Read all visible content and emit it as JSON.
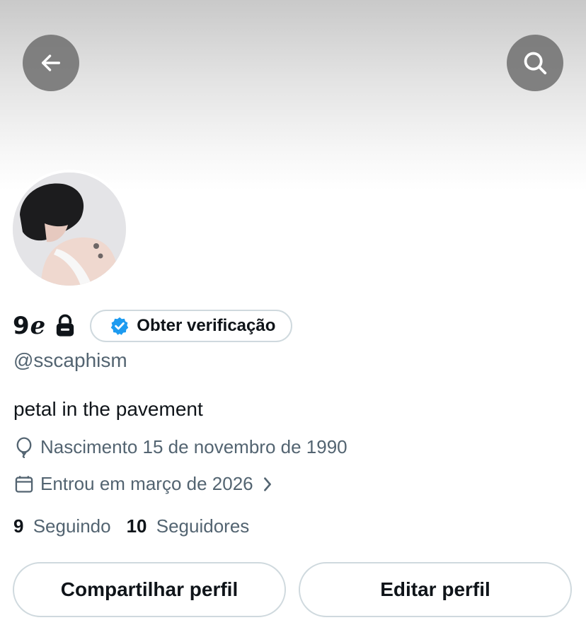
{
  "profile": {
    "display_name": "9ℯ",
    "handle": "@sscaphism",
    "bio": "petal in the pavement",
    "birth_label": "Nascimento 15 de novembro de 1990",
    "joined_label": "Entrou em março de 2026",
    "following_count": "9",
    "following_label": "Seguindo",
    "followers_count": "10",
    "followers_label": "Seguidores"
  },
  "verification": {
    "label": "Obter verificação"
  },
  "actions": {
    "share_label": "Compartilhar perfil",
    "edit_label": "Editar perfil"
  },
  "icons": {
    "back": "arrow-left-icon",
    "search": "search-icon",
    "lock": "lock-icon",
    "verified": "verified-badge-icon",
    "birthday": "balloon-icon",
    "calendar": "calendar-icon",
    "chevron": "chevron-right-icon"
  },
  "colors": {
    "text_primary": "#0f1419",
    "text_secondary": "#536471",
    "border": "#cfd9de",
    "verified_blue": "#1d9bf0",
    "header_button_bg": "#6e6e6e"
  }
}
